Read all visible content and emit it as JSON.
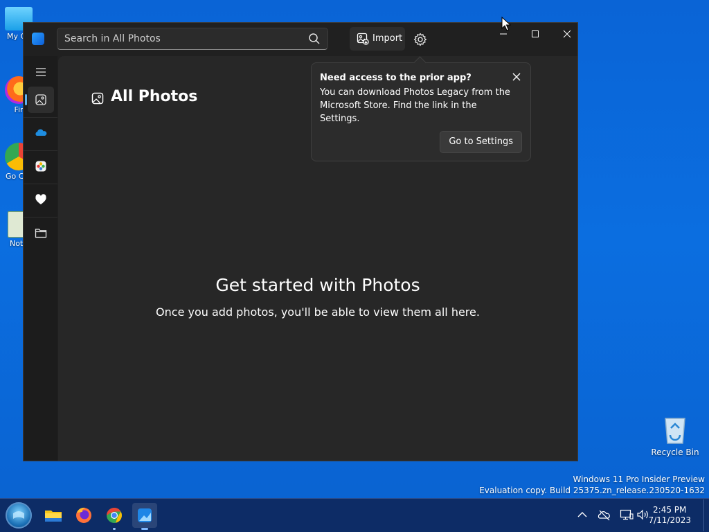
{
  "desktop": {
    "icons": [
      {
        "label": "My Co"
      },
      {
        "label": "Fir"
      },
      {
        "label": "Go Chr"
      },
      {
        "label": "Note"
      }
    ],
    "recycle_bin": "Recycle Bin",
    "watermark_line1": "Windows 11 Pro Insider Preview",
    "watermark_line2": "Evaluation copy. Build 25375.zn_release.230520-1632"
  },
  "app": {
    "search_placeholder": "Search in All Photos",
    "import_label": "Import",
    "page_title": "All Photos",
    "empty_title": "Get started with Photos",
    "empty_subtitle": "Once you add photos, you'll be able to view them all here.",
    "flyout": {
      "title": "Need access to the prior app?",
      "body": "You can download Photos Legacy from the Microsoft Store. Find the link in the Settings.",
      "button": "Go to Settings"
    },
    "nav": [
      {
        "name": "all-photos",
        "icon": "photo-icon",
        "active": true
      },
      {
        "name": "onedrive",
        "icon": "cloud-icon"
      },
      {
        "name": "icloud",
        "icon": "icloud-photos-icon"
      },
      {
        "name": "favorites",
        "icon": "heart-icon"
      },
      {
        "name": "folders",
        "icon": "folder-icon"
      }
    ]
  },
  "taskbar": {
    "time": "2:45 PM",
    "date": "7/11/2023"
  },
  "colors": {
    "accent": "#5fb2f2",
    "desktop_bg": "#0a64d6",
    "taskbar_bg": "#0d2c66"
  }
}
